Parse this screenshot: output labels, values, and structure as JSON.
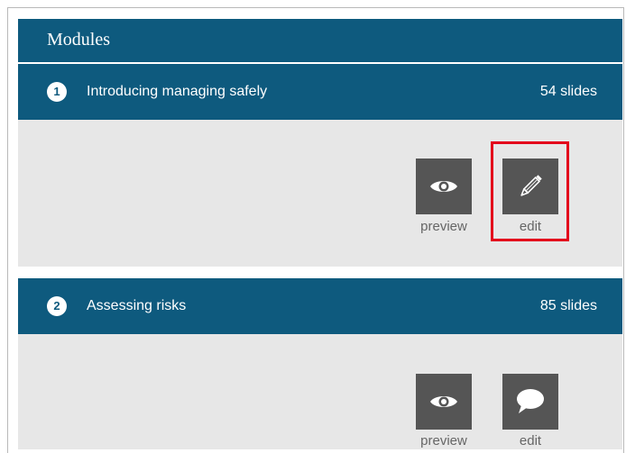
{
  "panel": {
    "title": "Modules"
  },
  "modules": [
    {
      "number": "1",
      "title": "Introducing managing safely",
      "slides": "54 slides",
      "actions": {
        "preview_label": "preview",
        "preview_icon": "eye-icon",
        "edit_label": "edit",
        "edit_icon": "pencil-icon"
      }
    },
    {
      "number": "2",
      "title": "Assessing risks",
      "slides": "85 slides",
      "actions": {
        "preview_label": "preview",
        "preview_icon": "eye-icon",
        "edit_label": "edit",
        "edit_icon": "speech-bubble-icon"
      }
    }
  ],
  "colors": {
    "header_bg": "#0e5a7e",
    "body_bg": "#e7e7e7",
    "tile_bg": "#555555",
    "highlight": "#e3001b"
  }
}
